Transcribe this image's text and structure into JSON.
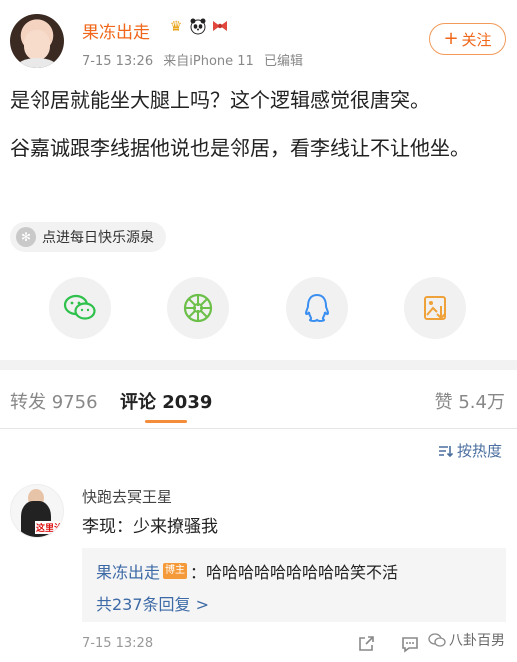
{
  "post": {
    "author": "果冻出走",
    "badges": [
      "crown",
      "panda",
      "bow"
    ],
    "time": "7-15 13:26",
    "source": "来自iPhone 11",
    "edited": "已编辑",
    "follow_label": "关注",
    "follow_plus": "+",
    "paragraphs": [
      "是邻居就能坐大腿上吗？这个逻辑感觉很唐突。",
      "谷嘉诚跟李线据他说也是邻居，看李线让不让他坐。"
    ],
    "topic": "点进每日快乐源泉"
  },
  "share": {
    "icons": [
      "wechat-icon",
      "moments-icon",
      "qq-icon",
      "save-image-icon"
    ],
    "colors": {
      "wechat": "#2ec14b",
      "moments": "#6cc04a",
      "qq": "#3a8ff0",
      "save": "#f0a23a"
    }
  },
  "tabs": {
    "repost_label": "转发",
    "repost_count": "9756",
    "comments_label": "评论",
    "comments_count": "2039",
    "likes_label": "赞",
    "likes_count": "5.4万"
  },
  "sort": {
    "label": "按热度"
  },
  "comment": {
    "author": "快跑去冥王星",
    "avatar_sign": "这里汐",
    "text": "李现：少来撩骚我",
    "reply": {
      "author": "果冻出走",
      "op_badge": "博主",
      "text": "：哈哈哈哈哈哈哈哈哈笑不活"
    },
    "more_replies": "共237条回复 >",
    "time": "7-15 13:28"
  },
  "watermark": {
    "text": "八卦百男"
  },
  "colors": {
    "accent": "#f0661a",
    "link": "#3d6aa6",
    "tab_underline": "#f58c3a"
  }
}
